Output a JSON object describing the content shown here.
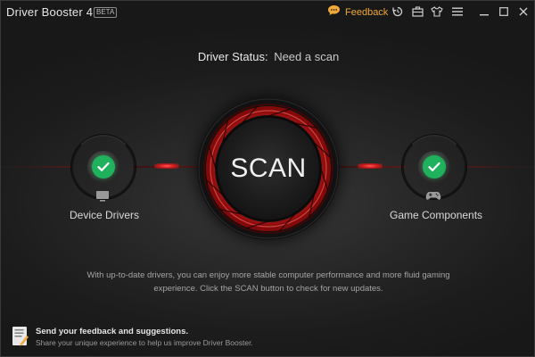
{
  "titlebar": {
    "app_name": "Driver Booster 4",
    "badge": "BETA",
    "feedback_label": "Feedback",
    "icons": [
      "feedback-bubble-icon",
      "restore-history-icon",
      "toolbox-icon",
      "skin-shirt-icon",
      "menu-icon",
      "minimize-icon",
      "maximize-icon",
      "close-icon"
    ]
  },
  "status": {
    "label": "Driver Status:",
    "value": "Need a scan"
  },
  "scan": {
    "label": "SCAN",
    "accent": "#e8232a"
  },
  "modules": {
    "left": {
      "label": "Device Drivers",
      "icon": "monitor-icon",
      "status_color": "#1fb15c"
    },
    "right": {
      "label": "Game Components",
      "icon": "gamepad-icon",
      "status_color": "#1fb15c"
    }
  },
  "info": {
    "line1": "With up-to-date drivers, you can enjoy more stable computer performance and more fluid gaming",
    "line2": "experience. Click the SCAN button to check for new updates."
  },
  "footer": {
    "title": "Send your feedback and suggestions.",
    "subtitle": "Share your unique experience to help us improve Driver Booster.",
    "icon": "feedback-document-icon"
  }
}
